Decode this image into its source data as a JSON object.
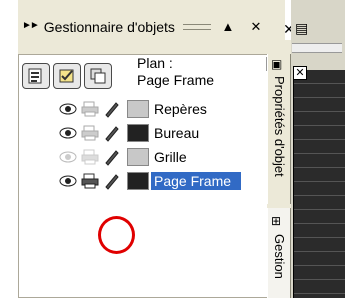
{
  "titlebar": {
    "title": "Gestionnaire d'objets",
    "arrows": "►►",
    "pin_label": "▲",
    "close_label": "✕"
  },
  "outer_close_label": "✕",
  "plan": {
    "label": "Plan :",
    "value": "Page Frame"
  },
  "layers": [
    {
      "name": "Repères",
      "swatch": "#c8c8c8",
      "visible": true,
      "selected": false
    },
    {
      "name": "Bureau",
      "swatch": "#222222",
      "visible": true,
      "selected": false
    },
    {
      "name": "Grille",
      "swatch": "#c8c8c8",
      "visible": false,
      "selected": false
    },
    {
      "name": "Page Frame",
      "swatch": "#222222",
      "visible": true,
      "selected": true
    }
  ],
  "tabs": [
    {
      "label": "Propriétés d'objet"
    },
    {
      "label": "Gestion"
    }
  ],
  "colors": {
    "selection": "#316ac5",
    "annotation": "#e00000",
    "panel": "#ece9d8"
  }
}
